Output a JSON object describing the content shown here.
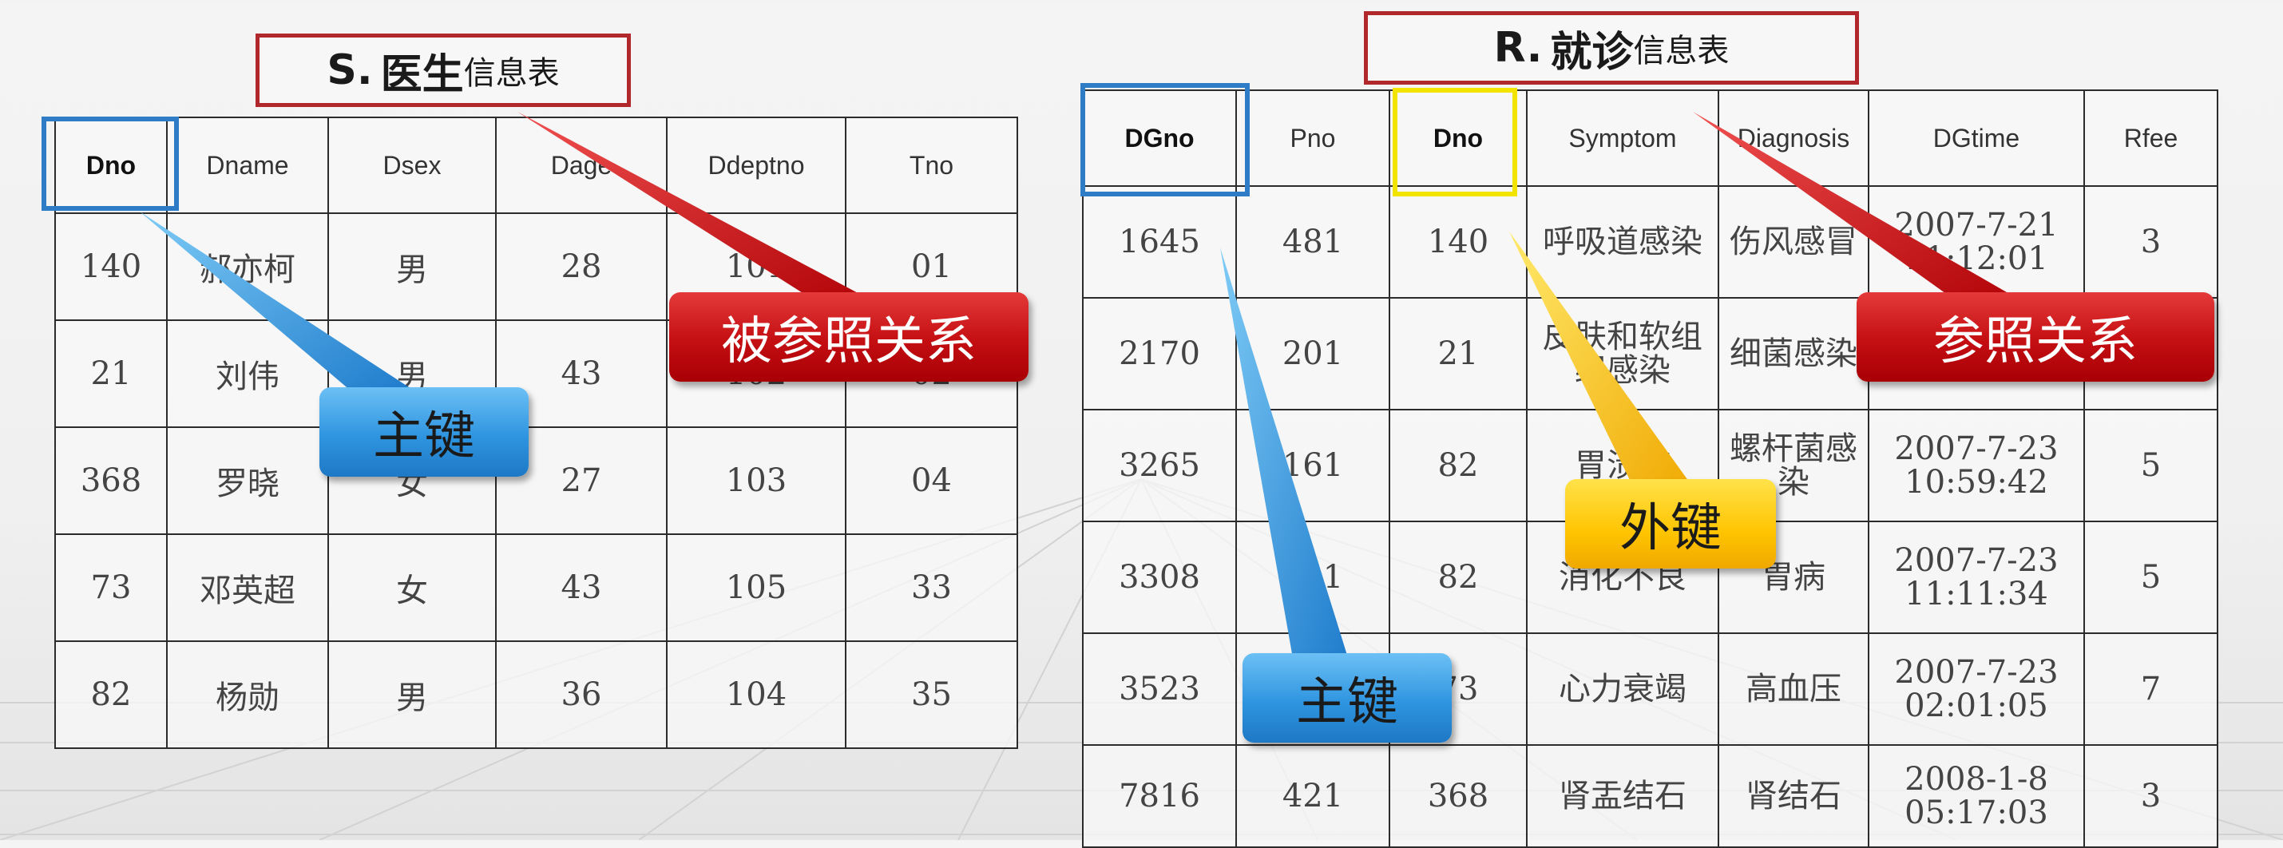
{
  "doctor_table": {
    "title_prefix": "S.",
    "title_main": "医生",
    "title_suffix": "信息表",
    "columns": [
      "Dno",
      "Dname",
      "Dsex",
      "Dage",
      "Ddeptno",
      "Tno"
    ],
    "rows": [
      [
        "140",
        "郝亦柯",
        "男",
        "28",
        "101",
        "01"
      ],
      [
        "21",
        "刘伟",
        "男",
        "43",
        "102",
        "02"
      ],
      [
        "368",
        "罗晓",
        "女",
        "27",
        "103",
        "04"
      ],
      [
        "73",
        "邓英超",
        "女",
        "43",
        "105",
        "33"
      ],
      [
        "82",
        "杨勋",
        "男",
        "36",
        "104",
        "35"
      ]
    ]
  },
  "visit_table": {
    "title_prefix": "R.",
    "title_main": "就诊",
    "title_suffix": "信息表",
    "columns": [
      "DGno",
      "Pno",
      "Dno",
      "Symptom",
      "Diagnosis",
      "DGtime",
      "Rfee"
    ],
    "rows": [
      [
        "1645",
        "481",
        "140",
        "呼吸道感染",
        "伤风感冒",
        "2007-7-21 11:12:01",
        "3"
      ],
      [
        "2170",
        "201",
        "21",
        "皮肤和软组织感染",
        "细菌感染",
        "",
        ""
      ],
      [
        "3265",
        "161",
        "82",
        "胃溃疡",
        "螺杆菌感染",
        "2007-7-23 10:59:42",
        "5"
      ],
      [
        "3308",
        "481",
        "82",
        "消化不良",
        "胃病",
        "2007-7-23 11:11:34",
        "5"
      ],
      [
        "3523",
        "",
        "73",
        "心力衰竭",
        "高血压",
        "2007-7-23 02:01:05",
        "7"
      ],
      [
        "7816",
        "421",
        "368",
        "肾盂结石",
        "肾结石",
        "2008-1-8 05:17:03",
        "3"
      ]
    ]
  },
  "callouts": {
    "referenced_relation": "被参照关系",
    "primary_key_left": "主键",
    "referencing_relation": "参照关系",
    "foreign_key": "外键",
    "primary_key_right": "主键"
  },
  "colors": {
    "title_border": "#b0282c",
    "primary_key_highlight": "#2e7cc6",
    "foreign_key_highlight": "#f3e400",
    "red_callout": "#c40e12",
    "blue_callout": "#2f95e0",
    "yellow_callout": "#ffc400"
  }
}
